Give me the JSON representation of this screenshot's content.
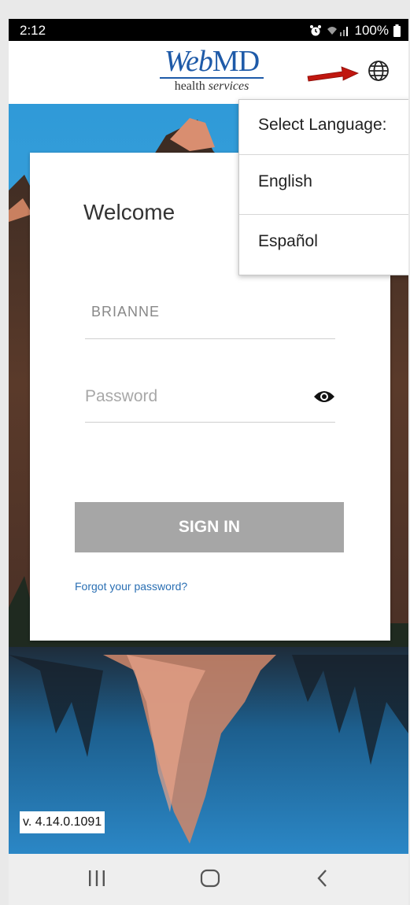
{
  "status_bar": {
    "time": "2:12",
    "battery_text": "100%"
  },
  "header": {
    "logo": {
      "main_web": "Web",
      "main_md": "MD",
      "sub_health": "health",
      "sub_services": "services"
    },
    "language_button_icon": "globe-icon",
    "annotation_arrow_color": "#c0170f"
  },
  "login": {
    "title": "Welcome",
    "username_value": "BRIANNE",
    "password_placeholder": "Password",
    "password_toggle_icon": "eye-icon",
    "sign_in_label": "SIGN IN",
    "sign_in_color": "#a6a6a6",
    "forgot_password_label": "Forgot your password?",
    "link_color": "#2a6fb3"
  },
  "language_menu": {
    "header": "Select Language:",
    "options": [
      "English",
      "Español"
    ]
  },
  "footer": {
    "version": "v. 4.14.0.1091"
  },
  "nav_bar": {
    "icons": [
      "recents-icon",
      "home-icon",
      "back-icon"
    ]
  },
  "colors": {
    "brand_blue": "#1e5aa8"
  }
}
